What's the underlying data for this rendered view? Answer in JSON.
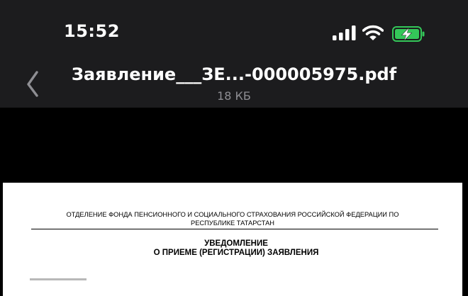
{
  "status_bar": {
    "time": "15:52",
    "icons": [
      "cellular-signal-icon",
      "wifi-icon",
      "battery-charging-icon"
    ],
    "battery_color": "#34c759"
  },
  "nav_bar": {
    "back_icon": "chevron-left-icon",
    "file_title": "Заявление___ЗЕ...-000005975.pdf",
    "file_size": "18 КБ",
    "accent_color": "#8e8e93"
  },
  "document": {
    "org_line_1": "ОТДЕЛЕНИЕ ФОНДА ПЕНСИОННОГО И СОЦИАЛЬНОГО СТРАХОВАНИЯ РОССИЙСКОЙ ФЕДЕРАЦИИ ПО",
    "org_line_2": "РЕСПУБЛИКЕ ТАТАРСТАН",
    "heading_1": "УВЕДОМЛЕНИЕ",
    "heading_2": "О ПРИЕМЕ (РЕГИСТРАЦИИ) ЗАЯВЛЕНИЯ"
  }
}
